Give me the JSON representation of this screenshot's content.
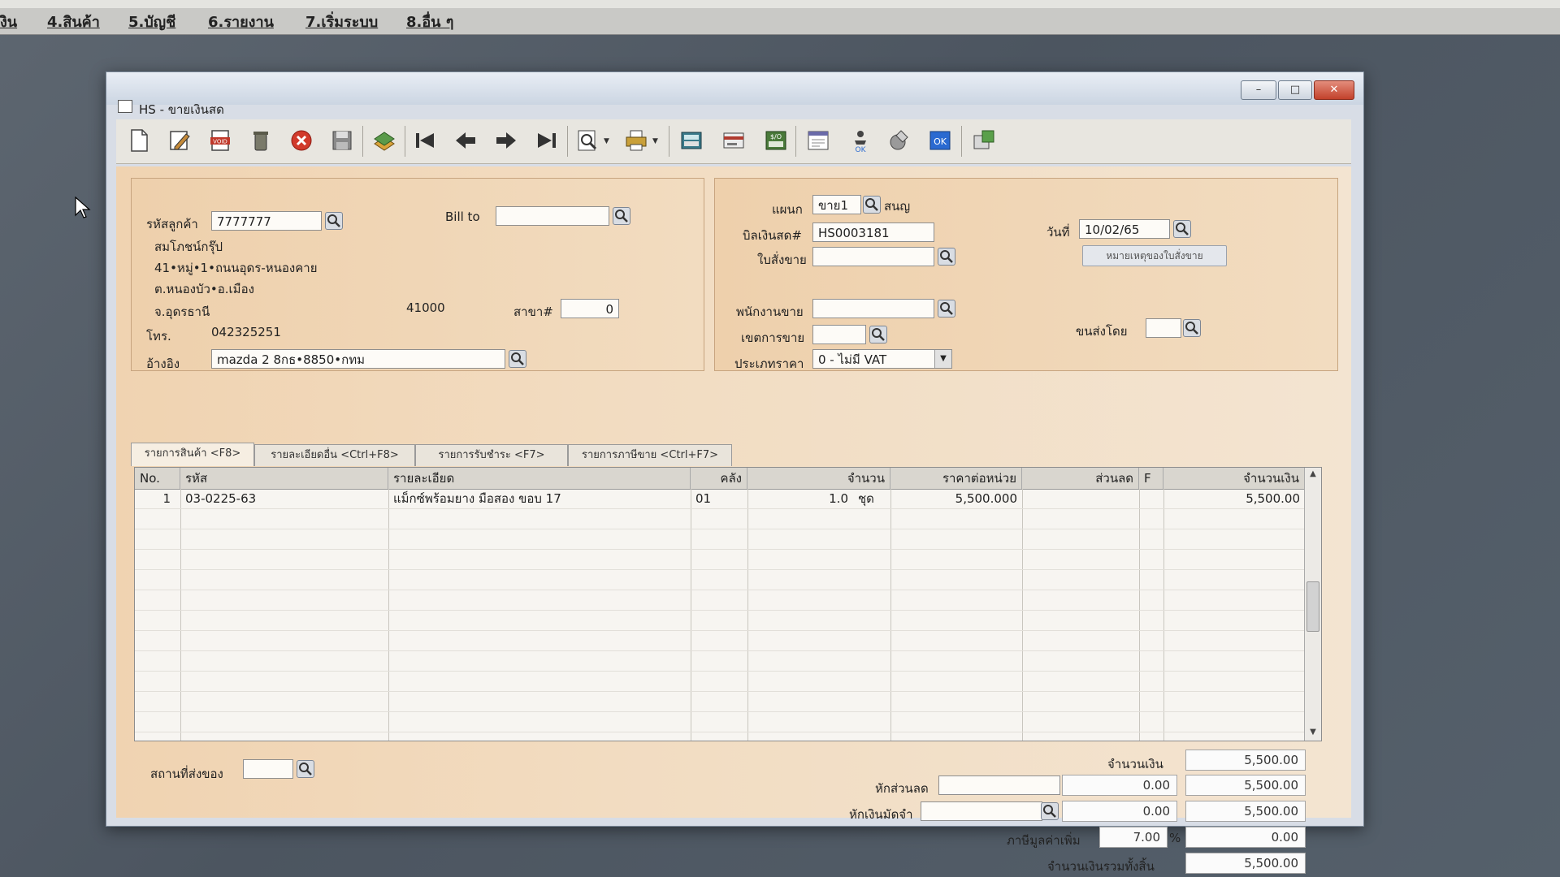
{
  "menu": {
    "items": [
      "งิน",
      "4.สินค้า",
      "5.บัญชี",
      "6.รายงาน",
      "7.เริ่มระบบ",
      "8.อื่น ๆ"
    ]
  },
  "window": {
    "title": "HS - ขายเงินสด",
    "controls": {
      "minimize": "–",
      "maximize": "□",
      "close": "✕"
    }
  },
  "toolbar": {
    "icons": [
      "new-icon",
      "edit-icon",
      "void-icon",
      "delete-icon",
      "cancel-icon",
      "save-icon",
      "stack-icon",
      "first-icon",
      "prev-icon",
      "next-icon",
      "last-icon",
      "find-icon",
      "print-icon",
      "calc-icon",
      "card-icon",
      "money-icon",
      "form-icon",
      "approve-icon",
      "tools-icon",
      "ok-icon",
      "export-icon"
    ]
  },
  "customer": {
    "code_label": "รหัสลูกค้า",
    "code": "7777777",
    "bill_to_label": "Bill to",
    "bill_to": "",
    "name": "สมโภชน์กรุ๊ป",
    "address1": "41•หมู่•1•ถนนอุดร-หนองคาย",
    "address2": "ต.หนองบัว•อ.เมือง",
    "province": "จ.อุดรธานี",
    "postcode": "41000",
    "branch_label": "สาขา#",
    "branch": "0",
    "phone_label": "โทร.",
    "phone": "042325251",
    "ref_label": "อ้างอิง",
    "ref": "mazda 2 8กธ•8850•กทม"
  },
  "doc": {
    "dept_label": "แผนก",
    "dept": "ขาย1",
    "dept_name": "สนญ",
    "bill_label": "บิลเงินสด#",
    "bill_no": "HS0003181",
    "order_label": "ใบสั่งขาย",
    "order": "",
    "date_label": "วันที่",
    "date": "10/02/65",
    "note_button": "หมายเหตุของใบสั่งขาย",
    "salesman_label": "พนักงานขาย",
    "salesman": "",
    "area_label": "เขตการขาย",
    "area": "",
    "ship_by_label": "ขนส่งโดย",
    "ship_by": "",
    "price_type_label": "ประเภทราคา",
    "price_type": "0 - ไม่มี VAT"
  },
  "tabs": [
    {
      "label": "รายการสินค้า <F8>",
      "active": true
    },
    {
      "label": "รายละเอียดอื่น <Ctrl+F8>",
      "active": false
    },
    {
      "label": "รายการรับชำระ <F7>",
      "active": false
    },
    {
      "label": "รายการภาษีขาย <Ctrl+F7>",
      "active": false
    }
  ],
  "grid": {
    "headers": {
      "no": "No.",
      "code": "รหัส",
      "desc": "รายละเอียด",
      "wh": "คลัง",
      "qty": "จำนวน",
      "price": "ราคาต่อหน่วย",
      "disc": "ส่วนลด",
      "f": "F",
      "amount": "จำนวนเงิน"
    },
    "rows": [
      {
        "no": "1",
        "code": "03-0225-63",
        "desc": "แม็กซ์พร้อมยาง มือสอง ขอบ 17",
        "wh": "01",
        "qty": "1.0",
        "unit": "ชุด",
        "price": "5,500.000",
        "disc": "",
        "f": "",
        "amount": "5,500.00"
      }
    ]
  },
  "footer": {
    "ship_place_label": "สถานที่ส่งของ",
    "ship_place": "",
    "amount_label": "จำนวนเงิน",
    "amount": "5,500.00",
    "discount_label": "หักส่วนลด",
    "discount_text": "",
    "discount_value": "0.00",
    "after_discount": "5,500.00",
    "deposit_label": "หักเงินมัดจำ",
    "deposit_text": "",
    "deposit_value": "0.00",
    "after_deposit": "5,500.00",
    "vat_label": "ภาษีมูลค่าเพิ่ม",
    "vat_rate": "7.00",
    "vat_pct": "%",
    "vat_amount": "0.00",
    "grand_total_label": "จำนวนเงินรวมทั้งสิ้น",
    "grand_total": "5,500.00"
  }
}
